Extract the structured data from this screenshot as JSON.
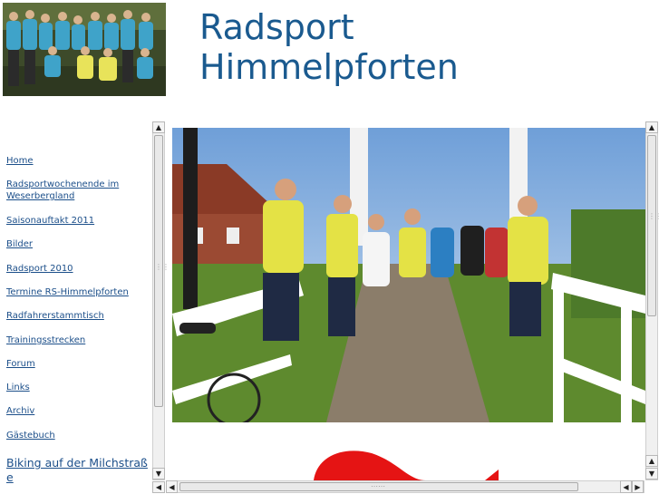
{
  "header": {
    "title_line1": "Radsport",
    "title_line2": "Himmelpforten",
    "title_color": "#1a5a8f"
  },
  "nav": {
    "link_color": "#1c4f8a",
    "items": [
      {
        "label": "Home"
      },
      {
        "label": "Radsportwochenende im"
      },
      {
        "label": "Weserbergland"
      },
      {
        "label": "Saisonauftakt 2011"
      },
      {
        "label": "Bilder"
      },
      {
        "label": "Radsport 2010"
      },
      {
        "label": "Termine RS-Himmelpforten"
      },
      {
        "label": "Radfahrerstammtisch"
      },
      {
        "label": "Trainingsstrecken"
      },
      {
        "label": "Forum"
      },
      {
        "label": "Links"
      },
      {
        "label": "Archiv"
      },
      {
        "label": "Gästebuch"
      },
      {
        "label": "Biking auf der Milchstraß"
      },
      {
        "label": "e"
      }
    ]
  },
  "icons": {
    "up": "arrow-up-icon",
    "down": "arrow-down-icon",
    "left": "arrow-left-icon",
    "right": "arrow-right-icon"
  }
}
